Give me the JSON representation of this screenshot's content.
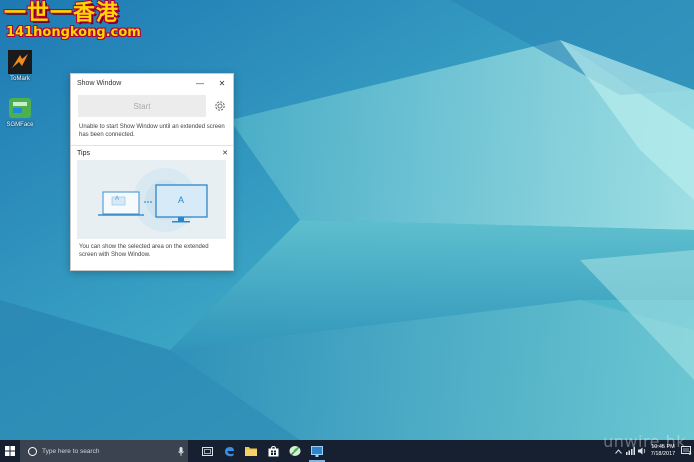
{
  "watermark": {
    "line1": "一世一香港",
    "line2": "141hongkong.com"
  },
  "desktop_icons": [
    {
      "label": "ToMark",
      "icon": "tomark-app-icon"
    },
    {
      "label": "SGMFace",
      "icon": "sgmface-app-icon"
    }
  ],
  "dialog": {
    "title": "Show Window",
    "minimize_glyph": "—",
    "close_glyph": "✕",
    "start_label": "Start",
    "message": "Unable to start Show Window until an extended screen has been connected.",
    "tips": {
      "title": "Tips",
      "close_glyph": "✕",
      "laptop_letter": "A",
      "monitor_letter": "A",
      "message": "You can show the selected area on the extended screen with Show Window."
    }
  },
  "taskbar": {
    "search_placeholder": "Type here to search",
    "apps": [
      {
        "icon": "task-view-icon"
      },
      {
        "icon": "edge-icon"
      },
      {
        "icon": "file-explorer-icon"
      },
      {
        "icon": "store-icon"
      },
      {
        "icon": "app-feather-icon"
      },
      {
        "icon": "show-window-icon",
        "active": true
      }
    ],
    "clock_time": "10:45 PM",
    "clock_date": "7/18/2017",
    "notification_count": "3"
  },
  "site_watermark": "unwire.hk",
  "colors": {
    "taskbar_bg": "#162030",
    "accent": "#2d86c9",
    "wallpaper_light": "#9fe0e6",
    "wallpaper_dark": "#1f6fa2"
  }
}
